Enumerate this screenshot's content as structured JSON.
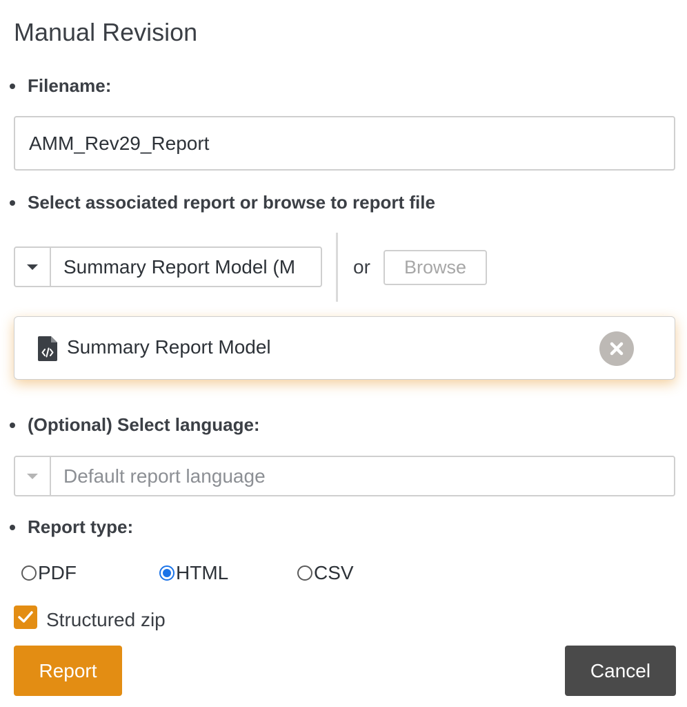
{
  "dialog": {
    "title": "Manual Revision"
  },
  "filename": {
    "label": "Filename:",
    "value": "AMM_Rev29_Report"
  },
  "report_select": {
    "label": "Select associated report or browse to report file",
    "selected": "Summary Report Model (M",
    "or_text": "or",
    "browse_label": "Browse"
  },
  "selected_file": {
    "name": "Summary Report Model",
    "icon": "code-file-icon"
  },
  "language": {
    "label": "(Optional) Select language:",
    "placeholder": "Default report language"
  },
  "report_type": {
    "label": "Report type:",
    "options": [
      {
        "label": "PDF",
        "checked": false
      },
      {
        "label": "HTML",
        "checked": true
      },
      {
        "label": "CSV",
        "checked": false
      }
    ]
  },
  "structured_zip": {
    "label": "Structured zip",
    "checked": true
  },
  "actions": {
    "report_label": "Report",
    "cancel_label": "Cancel"
  },
  "colors": {
    "accent": "#e38d13",
    "radio_selected": "#1a73e8",
    "cancel_bg": "#4a4a4a",
    "remove_bg": "#bdb9b5"
  }
}
